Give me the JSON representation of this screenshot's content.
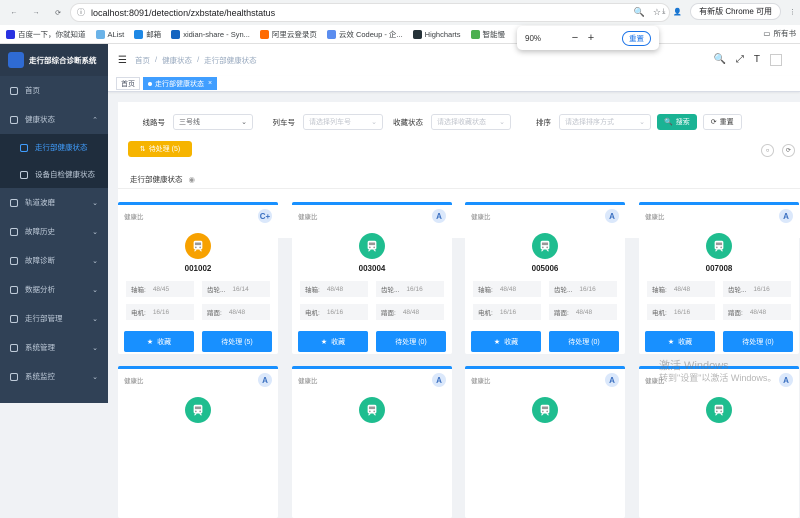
{
  "browser": {
    "url": "localhost:8091/detection/zxbstate/healthstatus",
    "update_label": "有新版 Chrome 可用",
    "zoom": {
      "value": "90%",
      "minus": "−",
      "plus": "+",
      "reset_label": "重置"
    },
    "bookmarks": [
      {
        "label": "百度一下，你就知道",
        "color": "#2932e1"
      },
      {
        "label": "AList",
        "color": "#6bb3e8"
      },
      {
        "label": "邮箱",
        "color": "#1e88e5"
      },
      {
        "label": "xidian-share - Syn...",
        "color": "#1565c0"
      },
      {
        "label": "阿里云登录页",
        "color": "#ff6a00"
      },
      {
        "label": "云效 Codeup - 企...",
        "color": "#5b8def"
      },
      {
        "label": "Highcharts",
        "color": "#263238"
      },
      {
        "label": "智能慢",
        "color": "#4caf50"
      }
    ],
    "bookmarks_right": "所有书"
  },
  "sidebar": {
    "title": "走行部综合诊断系统",
    "items": [
      {
        "label": "首页",
        "icon": "home-icon"
      },
      {
        "label": "健康状态",
        "icon": "health-icon",
        "expanded": true
      },
      {
        "label": "走行部健康状态",
        "sub": true,
        "active": true
      },
      {
        "label": "设备自检健康状态",
        "sub": true
      },
      {
        "label": "轨道波磨",
        "icon": "track-icon"
      },
      {
        "label": "故障历史",
        "icon": "history-icon"
      },
      {
        "label": "故障诊断",
        "icon": "diagnosis-icon"
      },
      {
        "label": "数据分析",
        "icon": "analysis-icon"
      },
      {
        "label": "走行部管理",
        "icon": "manage-icon"
      },
      {
        "label": "系统管理",
        "icon": "settings-icon"
      },
      {
        "label": "系统监控",
        "icon": "monitor-icon"
      }
    ]
  },
  "breadcrumb": [
    "首页",
    "健康状态",
    "走行部健康状态"
  ],
  "tags": [
    {
      "label": "首页"
    },
    {
      "label": "走行部健康状态",
      "active": true
    }
  ],
  "filters": {
    "line_label": "线路号",
    "line_value": "三号线",
    "train_label": "列车号",
    "train_placeholder": "请选择列车号",
    "fav_label": "收藏状态",
    "fav_placeholder": "请选择收藏状态",
    "sort_label": "排序",
    "sort_placeholder": "请选择排序方式",
    "search_label": "搜索",
    "reset_label": "重置"
  },
  "pending_button": "待处理 (5)",
  "section_title": "走行部健康状态",
  "card_common": {
    "health_label": "健康比",
    "k1": "轴箱:",
    "k2": "齿轮...",
    "k3": "电机:",
    "k4": "踏面:",
    "fav_label": "收藏"
  },
  "cards": [
    {
      "id": "001002",
      "grade": "C+",
      "status": "warning",
      "v1": "48/45",
      "v2": "16/14",
      "v3": "16/16",
      "v4": "48/48",
      "pending": "待处理 (5)"
    },
    {
      "id": "003004",
      "grade": "A",
      "status": "ok",
      "v1": "48/48",
      "v2": "16/16",
      "v3": "16/16",
      "v4": "48/48",
      "pending": "待处理 (0)"
    },
    {
      "id": "005006",
      "grade": "A",
      "status": "ok",
      "v1": "48/48",
      "v2": "16/16",
      "v3": "16/16",
      "v4": "48/48",
      "pending": "待处理 (0)"
    },
    {
      "id": "007008",
      "grade": "A",
      "status": "ok",
      "v1": "48/48",
      "v2": "16/16",
      "v3": "16/16",
      "v4": "48/48",
      "pending": "待处理 (0)"
    }
  ],
  "cards_row2": [
    {
      "grade": "A"
    },
    {
      "grade": "A"
    },
    {
      "grade": "A"
    },
    {
      "grade": "A"
    }
  ],
  "colors": {
    "warning": "#f7a100",
    "ok": "#1fbd8f",
    "primary": "#1890ff"
  },
  "watermark": {
    "line1": "激活 Windows",
    "line2": "转到\"设置\"以激活 Windows。"
  }
}
